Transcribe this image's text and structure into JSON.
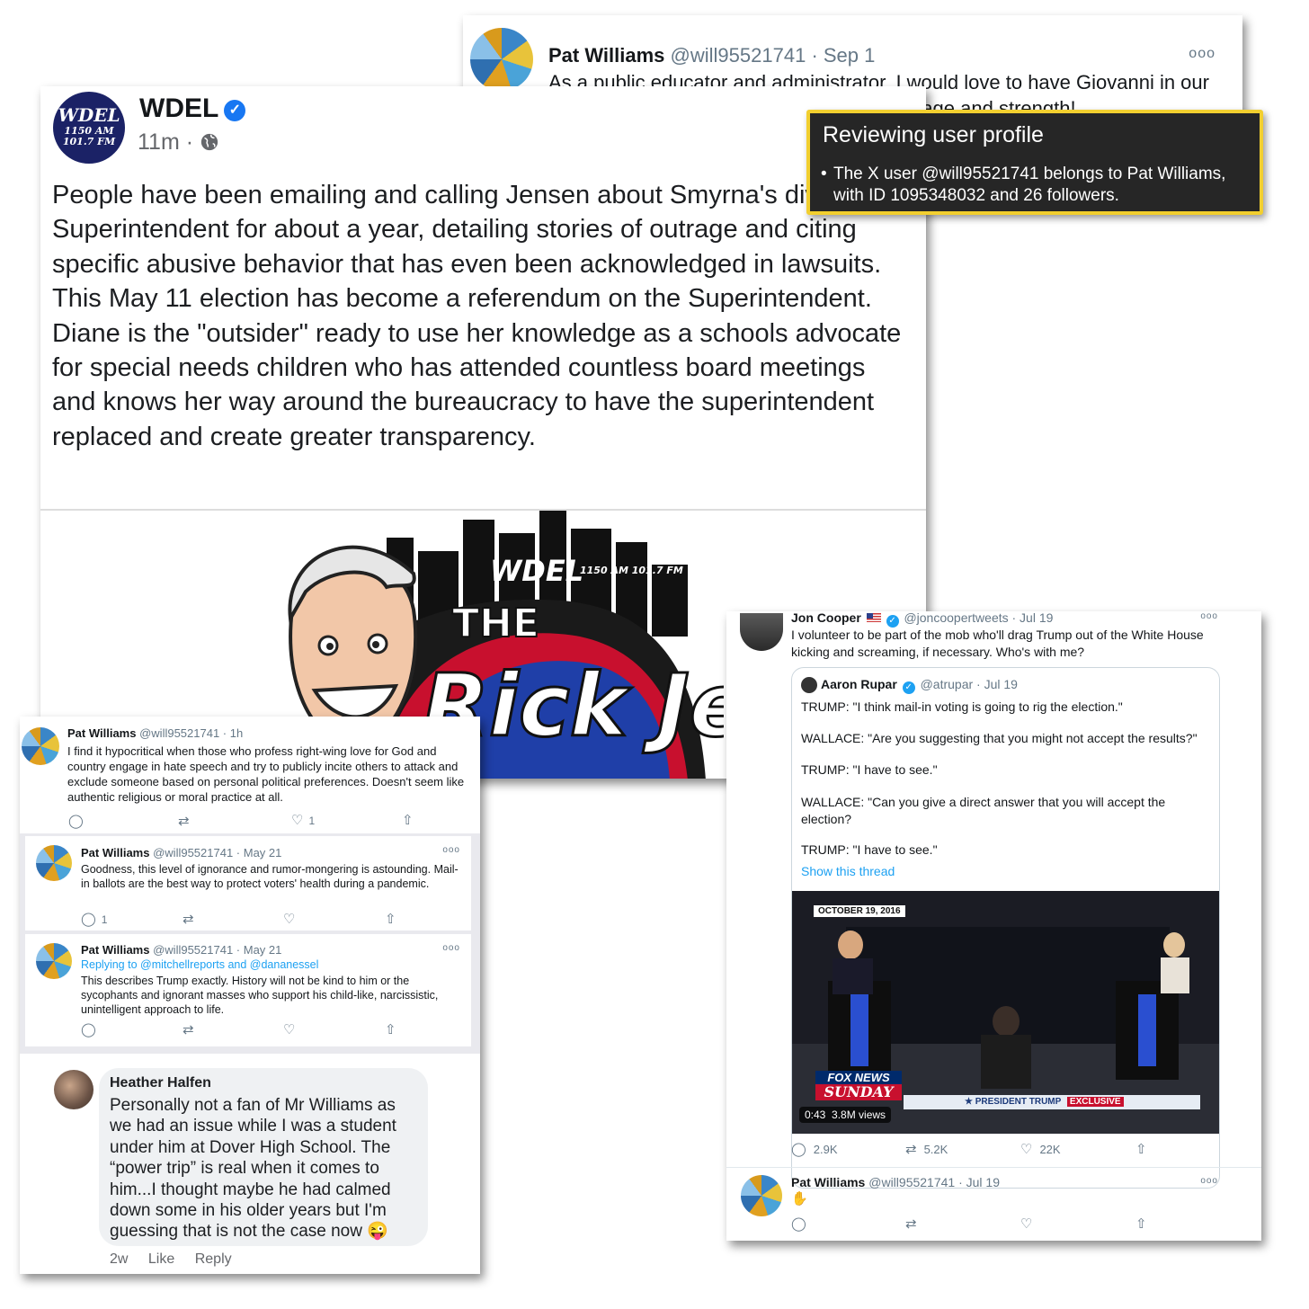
{
  "top_tweet": {
    "name": "Pat Williams",
    "handle": "@will95521741",
    "date": "· Sep 1",
    "text": "As a public educator and administrator, I would love to have Giovanni in our schools!  He is the model of resiliency, courage and strength!"
  },
  "tooltip": {
    "title": "Reviewing user profile",
    "bullet": "The X user @will95521741 belongs to Pat Williams, with ID 1095348032 and 26 followers."
  },
  "fb_post": {
    "logo_line1": "WDEL",
    "logo_line2": "1150 AM",
    "logo_line3": "101.7 FM",
    "name": "WDEL",
    "time": "11m ·",
    "text": "People have been emailing and calling Jensen about Smyrna's divisive Superintendent for about a year, detailing stories of outrage and citing specific abusive behavior that has even been acknowledged in lawsuits.  This May 11 election has become a referendum on the Superintendent.  Diane is the \"outsider\" ready to use her knowledge as a schools advocate for special needs children who has attended countless board meetings and knows her way around the bureaucracy to have the superintendent replaced and create greater transparency.",
    "art_station": "WDEL",
    "art_freq": "1150 AM 101.7 FM",
    "art_the": "THE",
    "art_name": "Rick Jensen"
  },
  "left_tweets": [
    {
      "name": "Pat Williams",
      "handle": "@will95521741 · 1h",
      "text": "I find it hypocritical when those who profess right-wing love for God and country engage in hate speech and try to publicly incite others to attack and exclude someone based on personal political preferences.  Doesn't seem like authentic religious or moral practice at all.",
      "likes": "1"
    },
    {
      "name": "Pat Williams",
      "handle": "@will95521741 · May 21",
      "text": "Goodness, this level of ignorance and rumor-mongering is astounding. Mail-in ballots are the best way to protect voters' health during a pandemic.",
      "replies": "1"
    },
    {
      "name": "Pat Williams",
      "handle": "@will95521741 · May 21",
      "replying_prefix": "Replying to ",
      "replying_to": "@mitchellreports and @dananessel",
      "text": "This describes Trump exactly.  History will not be kind to him or the sycophants and ignorant masses who support his child-like, narcissistic, unintelligent approach to life."
    }
  ],
  "fb_comment": {
    "name": "Heather Halfen",
    "text": "Personally not a fan of Mr Williams as we had an issue while I was a student under him at Dover High School. The “power trip” is real when it comes to him...I thought maybe he had calmed down some in his older years but I'm guessing that is not the case now 😜",
    "age": "2w",
    "like": "Like",
    "reply": "Reply"
  },
  "right_tweet": {
    "name": "Jon Cooper",
    "handle": "@joncoopertweets · Jul 19",
    "text": "I volunteer to be part of the mob who'll drag Trump out of the White House kicking and screaming, if necessary. Who's with me?",
    "quote": {
      "name": "Aaron Rupar",
      "handle": "@atrupar · Jul 19",
      "lines": [
        "TRUMP: \"I think mail-in voting is going to rig the election.\"",
        "WALLACE: \"Are you suggesting that you might not accept the results?\"",
        "TRUMP: \"I have to see.\"",
        "WALLACE: \"Can you give a direct answer that you will accept the election?",
        "TRUMP: \"I have to see.\""
      ],
      "show_thread": "Show this thread",
      "video_date": "OCTOBER 19, 2016",
      "video_brand1": "FOX NEWS",
      "video_brand2": "SUNDAY",
      "video_banner": "★ PRESIDENT TRUMP",
      "video_banner2": "EXCLUSIVE",
      "video_time": "0:43",
      "video_views": "3.8M views"
    },
    "replies": "2.9K",
    "retweets": "5.2K",
    "likes": "22K"
  },
  "right_reply": {
    "name": "Pat Williams",
    "handle": "@will95521741 · Jul 19",
    "text": "✋"
  },
  "icons": [
    "reply-icon",
    "retweet-icon",
    "like-icon",
    "share-icon",
    "more-icon",
    "verified-icon",
    "globe-icon"
  ]
}
